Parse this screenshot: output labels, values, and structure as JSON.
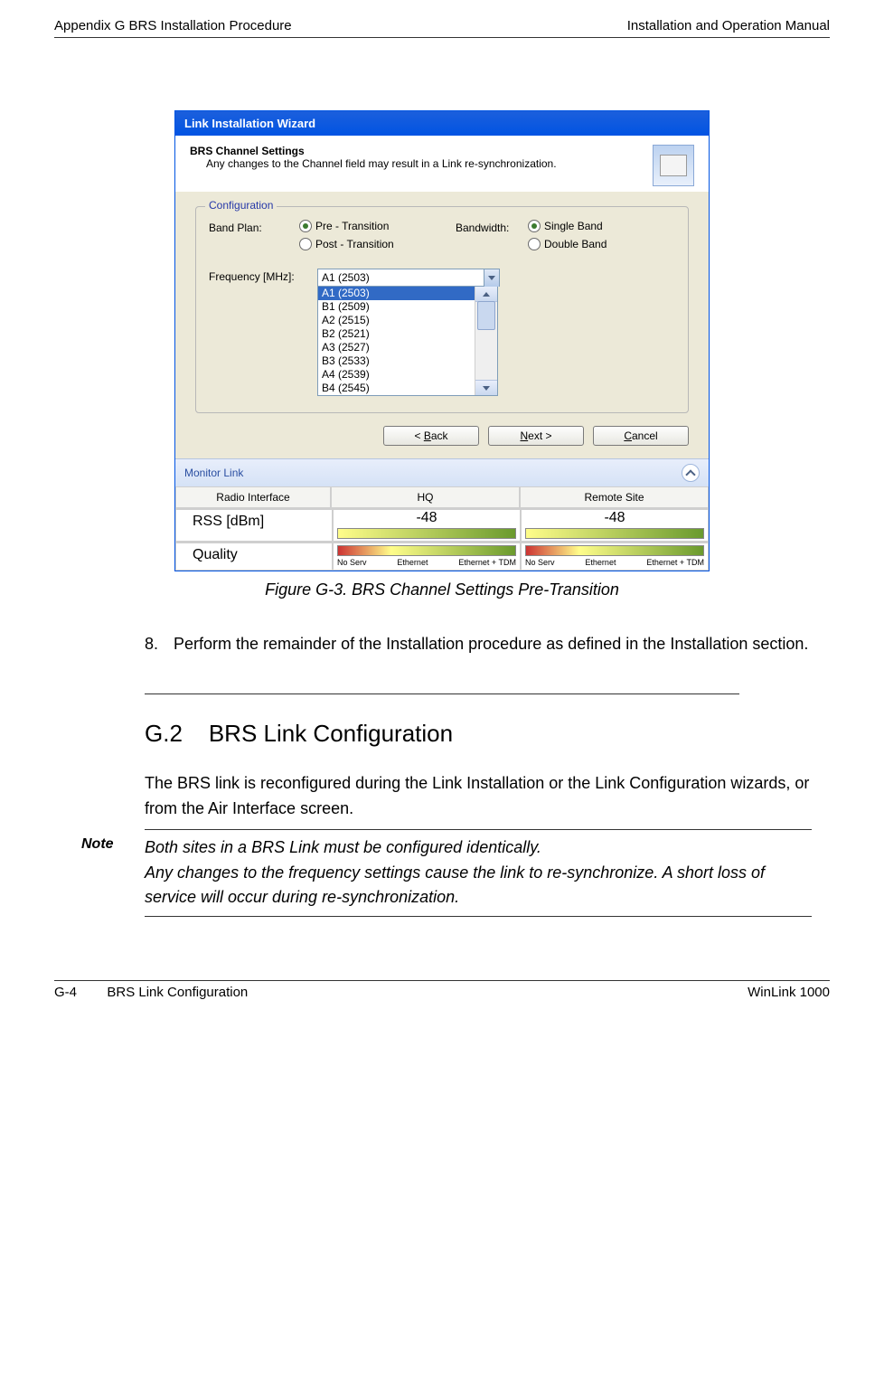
{
  "header": {
    "left": "Appendix G  BRS Installation Procedure",
    "right": "Installation and Operation Manual"
  },
  "wizard": {
    "title": "Link Installation Wizard",
    "heading": "BRS Channel Settings",
    "sub": "Any changes to the Channel field may result in a Link re-synchronization.",
    "config_legend": "Configuration",
    "bandplan_label": "Band Plan:",
    "bandplan_opts": {
      "pre": "Pre - Transition",
      "post": "Post - Transition"
    },
    "bandwidth_label": "Bandwidth:",
    "bandwidth_opts": {
      "single": "Single Band",
      "double": "Double Band"
    },
    "freq_label": "Frequency [MHz]:",
    "freq_selected": "A1 (2503)",
    "freq_list": [
      "A1 (2503)",
      "B1 (2509)",
      "A2 (2515)",
      "B2 (2521)",
      "A3 (2527)",
      "B3 (2533)",
      "A4 (2539)",
      "B4 (2545)"
    ],
    "buttons": {
      "back": "< Back",
      "next": "Next >",
      "cancel": "Cancel"
    },
    "monitor": {
      "title": "Monitor Link",
      "cols": {
        "c1": "Radio Interface",
        "c2": "HQ",
        "c3": "Remote Site"
      },
      "rss_label": "RSS [dBm]",
      "rss_hq": "-48",
      "rss_remote": "-48",
      "quality_label": "Quality",
      "scale": {
        "a": "No Serv",
        "b": "Ethernet",
        "c": "Ethernet + TDM"
      }
    }
  },
  "caption": "Figure G-3.  BRS Channel Settings Pre-Transition",
  "step8_num": "8.",
  "step8": "Perform the remainder of the Installation procedure as defined in the Installation section.",
  "section": {
    "num": "G.2",
    "title": "BRS Link Configuration"
  },
  "para1": "The BRS link is reconfigured during the Link Installation or the Link Configuration wizards, or from the Air Interface screen.",
  "note_label": "Note",
  "note1": "Both sites in a BRS Link must be configured identically.",
  "note2": "Any changes to the frequency settings cause the link to re-synchronize. A short loss of service will occur during re-synchronization.",
  "footer": {
    "left": "G-4",
    "center": "BRS Link Configuration",
    "right": "WinLink 1000"
  }
}
